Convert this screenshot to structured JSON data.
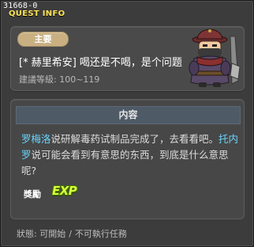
{
  "window": {
    "quest_id": "31668-0",
    "title": "QUEST INFO"
  },
  "quest": {
    "category": "主要",
    "name": "[* 赫里希安] 喝还是不喝，是个问题",
    "recommended_level": "建議等級: 100~119",
    "npc_icon": "npc-portrait-icon"
  },
  "content": {
    "header": "内容",
    "description": [
      {
        "text": "罗梅洛",
        "highlight": true
      },
      {
        "text": "说研解毒药试制品完成了，去看看吧。",
        "highlight": false
      },
      {
        "text": "托内罗",
        "highlight": true
      },
      {
        "text": "说可能会看到有意思的东西，到底是什么意思呢?",
        "highlight": false
      }
    ],
    "reward_label": "獎勵",
    "reward_icon_text": "EXP"
  },
  "status": {
    "label": "狀態",
    "value": "可開始",
    "separator": "/",
    "extra": "不可執行任務"
  },
  "colors": {
    "highlight": "#68d6ff",
    "title": "#ffe35a",
    "badge": "#c9b083",
    "exp": "#d9ff3a"
  }
}
